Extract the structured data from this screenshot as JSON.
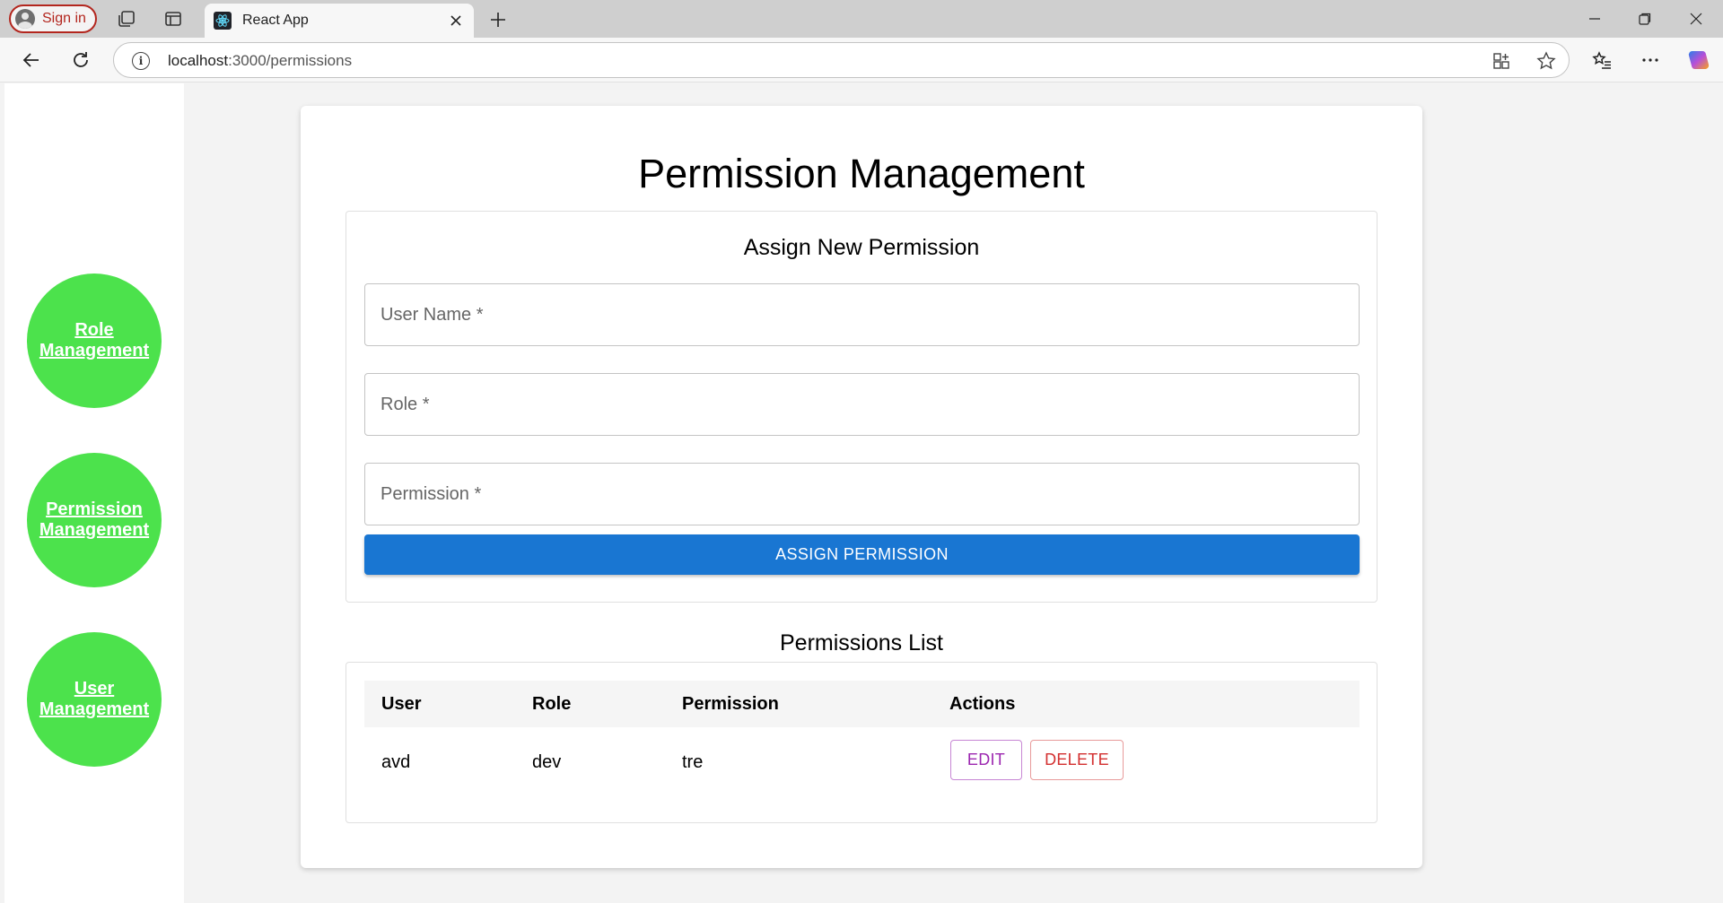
{
  "browser": {
    "signin_label": "Sign in",
    "tab_title": "React App",
    "url_host": "localhost",
    "url_path": ":3000/permissions"
  },
  "sidebar": {
    "items": [
      {
        "line1": "Role",
        "line2": "Management"
      },
      {
        "line1": "Permission",
        "line2": "Management"
      },
      {
        "line1": "User",
        "line2": "Management"
      }
    ]
  },
  "page": {
    "title": "Permission Management",
    "form": {
      "title": "Assign New Permission",
      "user_placeholder": "User Name *",
      "role_placeholder": "Role *",
      "permission_placeholder": "Permission *",
      "submit_label": "ASSIGN PERMISSION"
    },
    "list": {
      "title": "Permissions List",
      "columns": [
        "User",
        "Role",
        "Permission",
        "Actions"
      ],
      "rows": [
        {
          "user": "avd",
          "role": "dev",
          "permission": "tre",
          "edit_label": "EDIT",
          "delete_label": "DELETE"
        }
      ]
    }
  },
  "colors": {
    "nav_circle": "#4ce24c",
    "primary": "#1976d2",
    "edit": "#9c27b0",
    "delete": "#d32f2f"
  }
}
